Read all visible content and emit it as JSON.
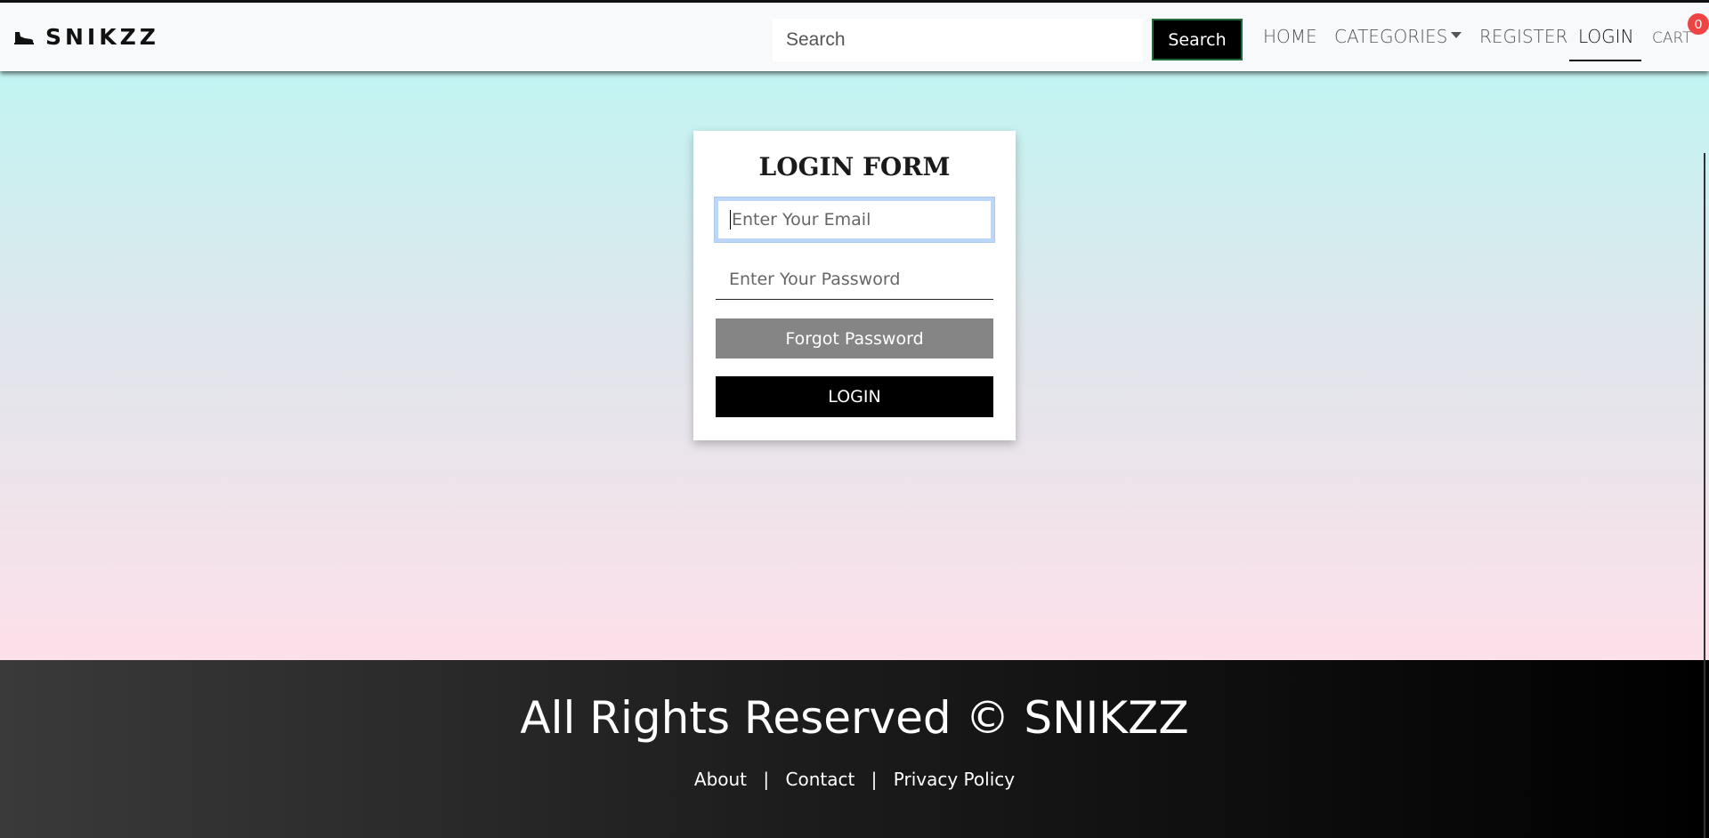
{
  "header": {
    "brand": "SNIKZZ",
    "search": {
      "placeholder": "Search",
      "button_label": "Search"
    },
    "nav": {
      "home": "HOME",
      "categories": "CATEGORIES",
      "register": "REGISTER",
      "login": "LOGIN",
      "cart": "CART",
      "cart_count": "0"
    }
  },
  "login_form": {
    "title": "LOGIN FORM",
    "email_placeholder": "Enter Your Email",
    "password_placeholder": "Enter Your Password",
    "forgot_label": "Forgot Password",
    "login_label": "LOGIN"
  },
  "footer": {
    "copyright": "All Rights Reserved © SNIKZZ",
    "links": [
      "About",
      "Contact",
      "Privacy Policy"
    ],
    "separator": "|"
  },
  "colors": {
    "gradient_top": "#c2f5f3",
    "gradient_bottom": "#fde0e9",
    "badge": "#ef4444"
  }
}
